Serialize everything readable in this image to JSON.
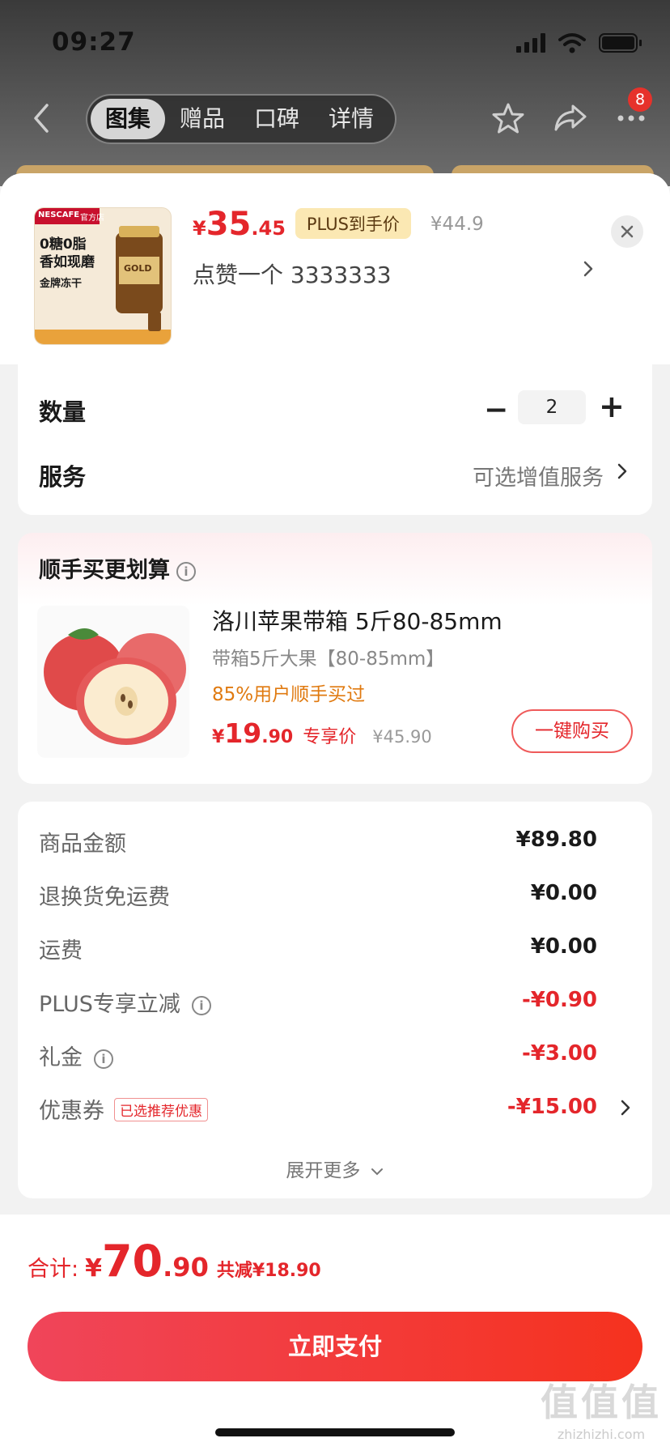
{
  "status_bar": {
    "time": "09:27"
  },
  "nav": {
    "tabs": [
      {
        "label": "图集",
        "active": true
      },
      {
        "label": "赠品",
        "active": false
      },
      {
        "label": "口碑",
        "active": false
      },
      {
        "label": "详情",
        "active": false
      }
    ],
    "badge_count": "8"
  },
  "product": {
    "thumb": {
      "brand": "NESCAFE",
      "store": "官方店",
      "headline_1": "0糖0脂",
      "headline_2": "香如现磨",
      "subtitle": "金牌冻干",
      "jar_label": "GOLD"
    },
    "price_currency": "¥",
    "price_int": "35",
    "price_dec": ".45",
    "plus_tag": "PLUS到手价",
    "original_price": "¥44.9",
    "variant": "点赞一个  3333333"
  },
  "quantity": {
    "label": "数量",
    "value": "2",
    "minus": "−",
    "plus": "+"
  },
  "service": {
    "label": "服务",
    "value": "可选增值服务"
  },
  "upsell": {
    "title": "顺手买更划算",
    "info": "i",
    "name": "洛川苹果带箱 5斤80-85mm",
    "spec": "带箱5斤大果【80-85mm】",
    "rate": "85%用户顺手买过",
    "price_currency": "¥",
    "price_int": "19",
    "price_dec": ".90",
    "exclusive_label": "专享价",
    "original_price": "¥45.90",
    "buy_button": "一键购买"
  },
  "fees": [
    {
      "label": "商品金额",
      "value": "¥89.80",
      "red": false,
      "info": false
    },
    {
      "label": "退换货免运费",
      "value": "¥0.00",
      "red": false,
      "info": false
    },
    {
      "label": "运费",
      "value": "¥0.00",
      "red": false,
      "info": false
    },
    {
      "label": "PLUS专享立减",
      "value": "-¥0.90",
      "red": true,
      "info": true
    },
    {
      "label": "礼金",
      "value": "-¥3.00",
      "red": true,
      "info": true
    },
    {
      "label": "优惠券",
      "value": "-¥15.00",
      "red": true,
      "info": false,
      "tag": "已选推荐优惠"
    }
  ],
  "expand_more": "展开更多",
  "total": {
    "label": "合计:",
    "currency": "¥",
    "int": "70",
    "dec": ".90",
    "discount": "共减¥18.90"
  },
  "pay_button": "立即支付",
  "watermark": {
    "big": "值值值",
    "small": "zhizhizhi.com"
  },
  "colors": {
    "accent_red": "#e4262b",
    "plus_gold": "#fbe8b3",
    "rate_orange": "#e07a10"
  }
}
